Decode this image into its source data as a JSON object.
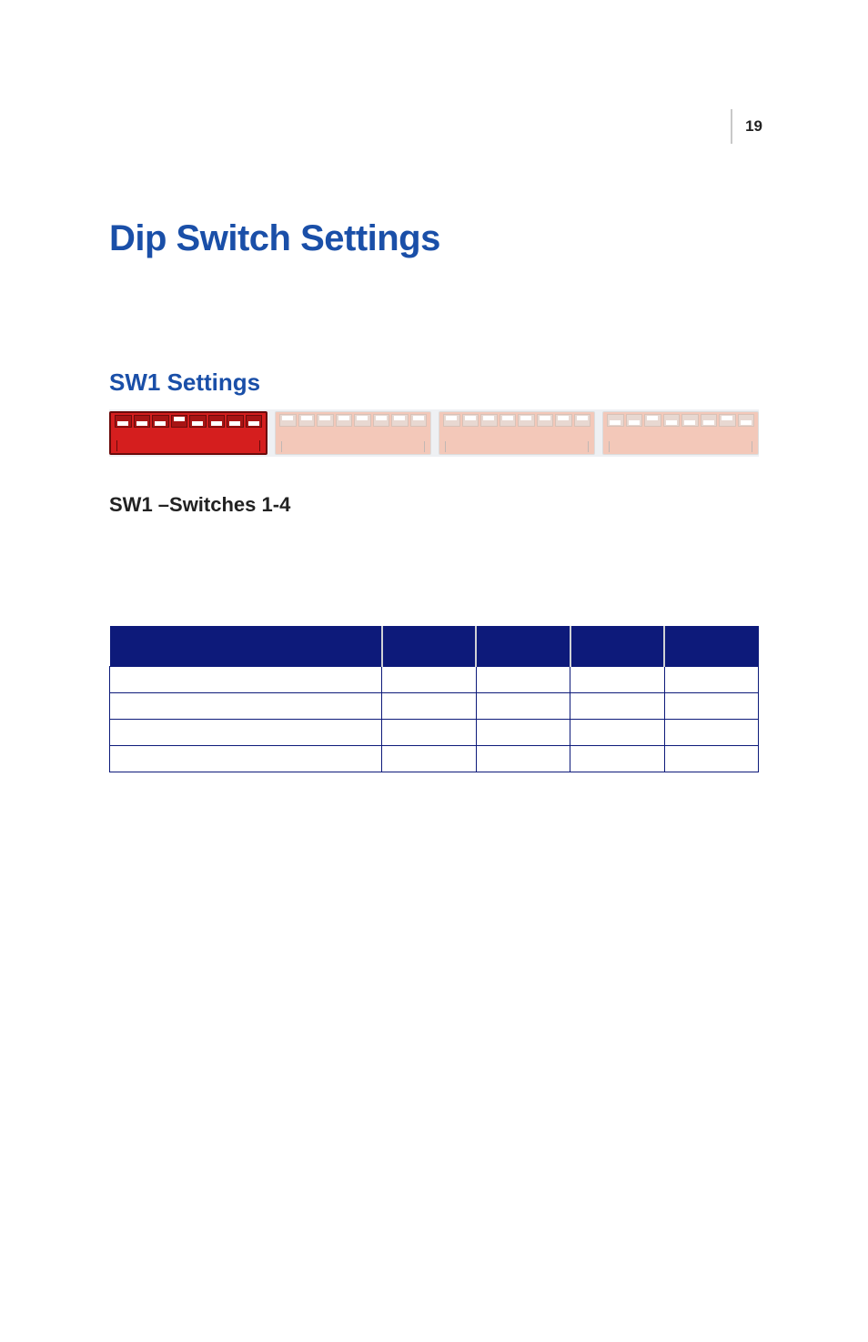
{
  "page_number": "19",
  "heading1": "Dip Switch Settings",
  "heading2": "SW1 Settings",
  "heading3": "SW1 –Switches 1-4",
  "dip_banks": [
    {
      "name": "sw1-bank",
      "active": true,
      "switches": [
        "down",
        "down",
        "down",
        "up",
        "down",
        "down",
        "down",
        "down"
      ]
    },
    {
      "name": "sw2-bank",
      "active": false,
      "switches": [
        "up",
        "up",
        "up",
        "up",
        "up",
        "up",
        "up",
        "up"
      ]
    },
    {
      "name": "sw3-bank",
      "active": false,
      "switches": [
        "up",
        "up",
        "up",
        "up",
        "up",
        "up",
        "up",
        "up"
      ]
    },
    {
      "name": "sw4-bank",
      "active": false,
      "switches": [
        "down",
        "down",
        "up",
        "down",
        "down",
        "down",
        "up",
        "down"
      ]
    }
  ],
  "table": {
    "headers": [
      "",
      "",
      "",
      "",
      ""
    ],
    "rows": [
      [
        "",
        "",
        "",
        "",
        ""
      ],
      [
        "",
        "",
        "",
        "",
        ""
      ],
      [
        "",
        "",
        "",
        "",
        ""
      ],
      [
        "",
        "",
        "",
        "",
        ""
      ]
    ]
  }
}
